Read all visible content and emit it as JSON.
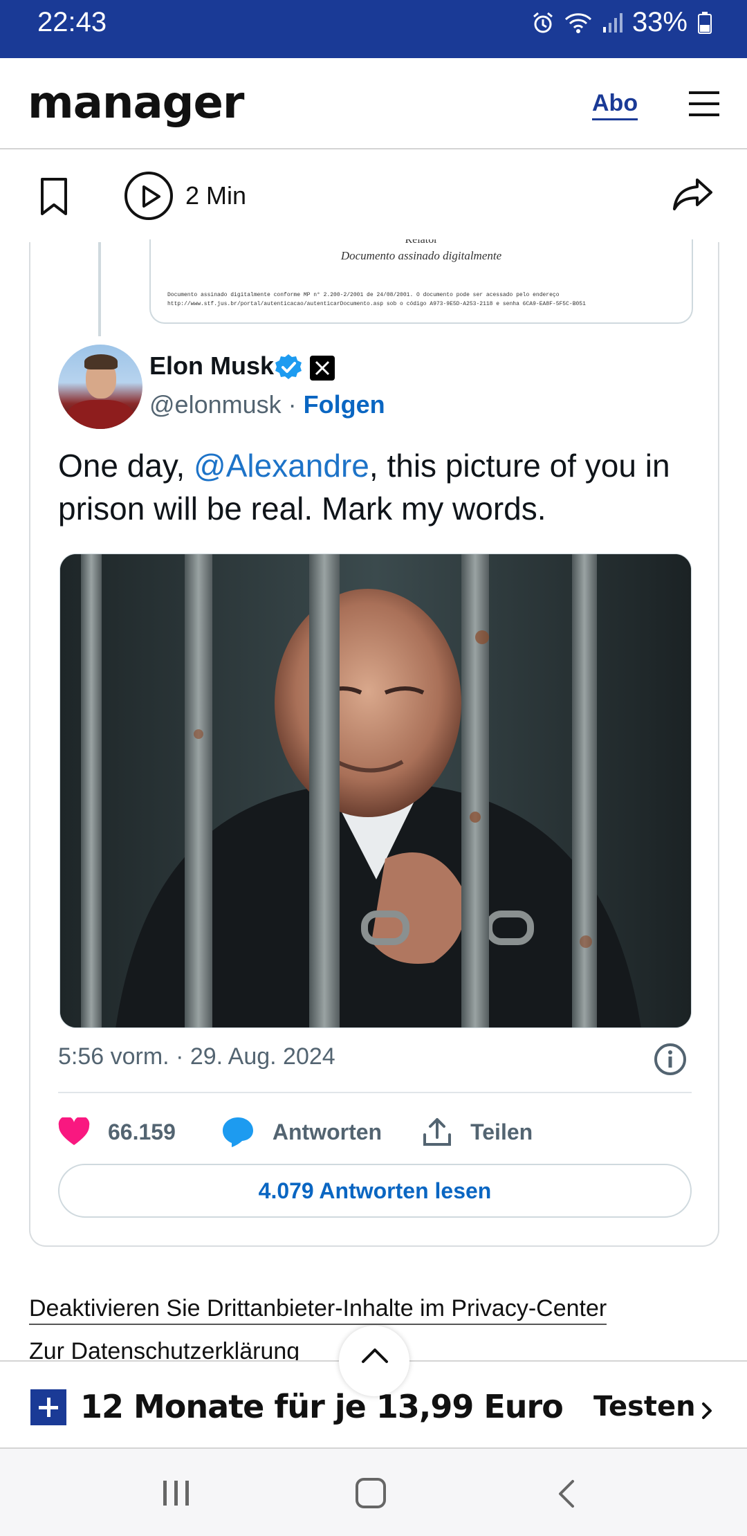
{
  "status_bar": {
    "time": "22:43",
    "battery": "33%",
    "icons": [
      "alarm-icon",
      "wifi-icon",
      "signal-icon",
      "battery-icon"
    ]
  },
  "header": {
    "logo": "manager",
    "abo_label": "Abo",
    "menu_icon": "hamburger-menu-icon",
    "brand_color": "#1a3a96"
  },
  "toolbar": {
    "duration": "2 Min",
    "icons": [
      "bookmark-icon",
      "play-icon",
      "share-icon"
    ]
  },
  "tweet": {
    "quoted_doc": {
      "relator": "Relator",
      "signed": "Documento assinado digitalmente",
      "fine_print_1": "Documento assinado digitalmente conforme MP n° 2.200-2/2001 de 24/08/2001. O documento pode ser acessado pelo endereço",
      "fine_print_2": "http://www.stf.jus.br/portal/autenticacao/autenticarDocumento.asp sob o código A973-9E5D-A253-2118 e senha 6CA9-EA8F-5F5C-B051"
    },
    "author_name": "Elon Musk",
    "handle": "@elonmusk",
    "separator": " · ",
    "follow_label": "Folgen",
    "text_before": "One day, ",
    "mention": "@Alexandre",
    "text_after": ", this picture of you in prison will be real. Mark my words.",
    "timestamp": "5:56 vorm. · 29. Aug. 2024",
    "like_count": "66.159",
    "reply_label": "Antworten",
    "share_label": "Teilen",
    "read_replies_label": "4.079 Antworten lesen",
    "colors": {
      "like": "#f91880",
      "reply": "#1d9bf0",
      "link": "#0a66c2"
    }
  },
  "privacy": {
    "link1": "Deaktivieren Sie Drittanbieter-Inhalte im Privacy-Center",
    "link2": "Zur Datenschutzerklärung"
  },
  "promo": {
    "text": "12 Monate für je 13,99 Euro",
    "cta": "Testen"
  },
  "nav": {
    "icons": [
      "recents-icon",
      "home-icon",
      "back-icon"
    ]
  }
}
